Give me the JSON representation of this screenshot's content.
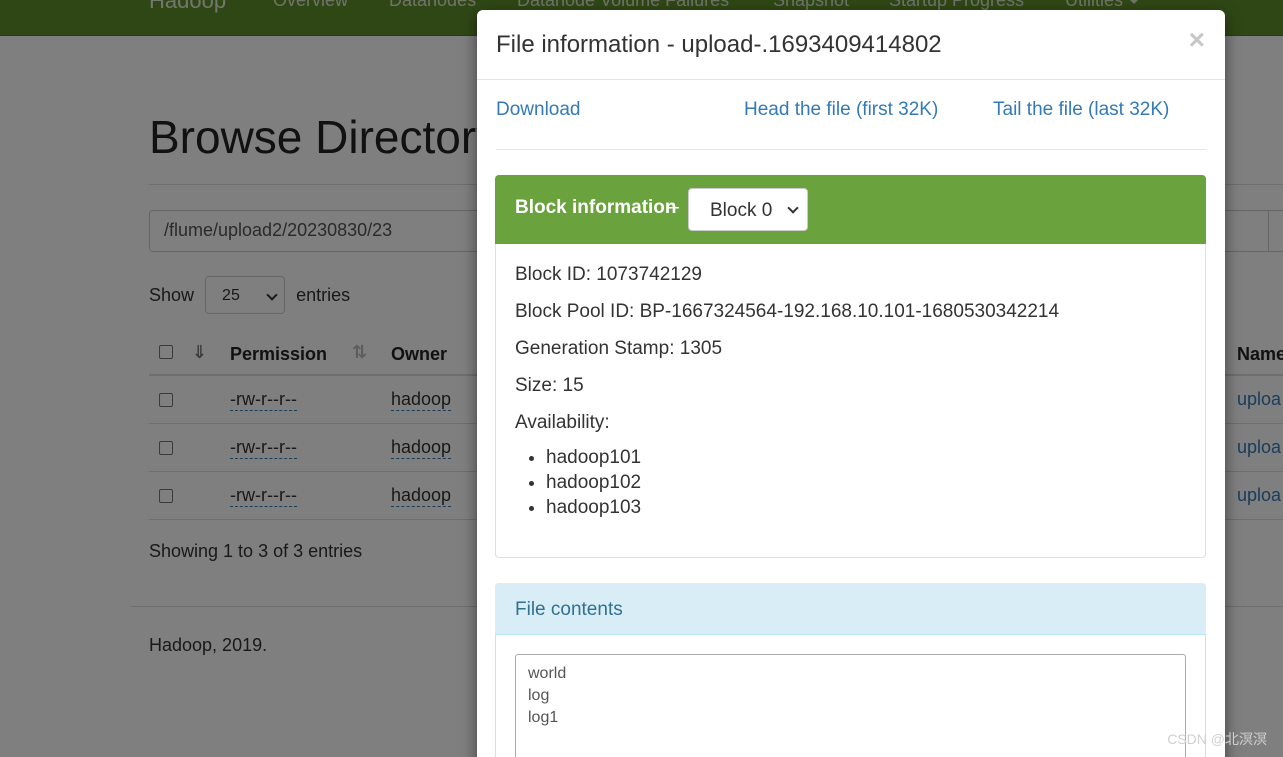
{
  "navbar": {
    "brand": "Hadoop",
    "items": [
      "Overview",
      "Datanodes",
      "Datanode Volume Failures",
      "Snapshot",
      "Startup Progress",
      "Utilities"
    ]
  },
  "page": {
    "title": "Browse Directory",
    "path_value": "/flume/upload2/20230830/23",
    "show_label": "Show",
    "entries_value": "25",
    "entries_label": "entries",
    "columns": [
      "Permission",
      "Owner",
      "Name"
    ],
    "rows": [
      {
        "permission": "-rw-r--r--",
        "owner": "hadoop",
        "name": "uploa"
      },
      {
        "permission": "-rw-r--r--",
        "owner": "hadoop",
        "name": "uploa"
      },
      {
        "permission": "-rw-r--r--",
        "owner": "hadoop",
        "name": "uploa"
      }
    ],
    "showing": "Showing 1 to 3 of 3 entries",
    "footer": "Hadoop, 2019."
  },
  "modal": {
    "title": "File information - upload-.1693409414802",
    "close": "×",
    "links": {
      "download": "Download",
      "head": "Head the file (first 32K)",
      "tail": "Tail the file (last 32K)"
    },
    "block_panel": {
      "title": "Block information",
      "separator": "--",
      "selected_block": "Block 0",
      "block_id": "Block ID: 1073742129",
      "block_pool_id": "Block Pool ID: BP-1667324564-192.168.10.101-1680530342214",
      "generation_stamp": "Generation Stamp: 1305",
      "size": "Size: 15",
      "availability_label": "Availability:",
      "availability": [
        "hadoop101",
        "hadoop102",
        "hadoop103"
      ]
    },
    "contents_panel": {
      "title": "File contents",
      "content": "world\nlog\nlog1"
    }
  },
  "watermark": "CSDN @北溟溟",
  "colors": {
    "navbar": "#5f8e2a",
    "block_header": "#6aa23d",
    "info_header": "#d9edf7",
    "link": "#337ab7"
  }
}
